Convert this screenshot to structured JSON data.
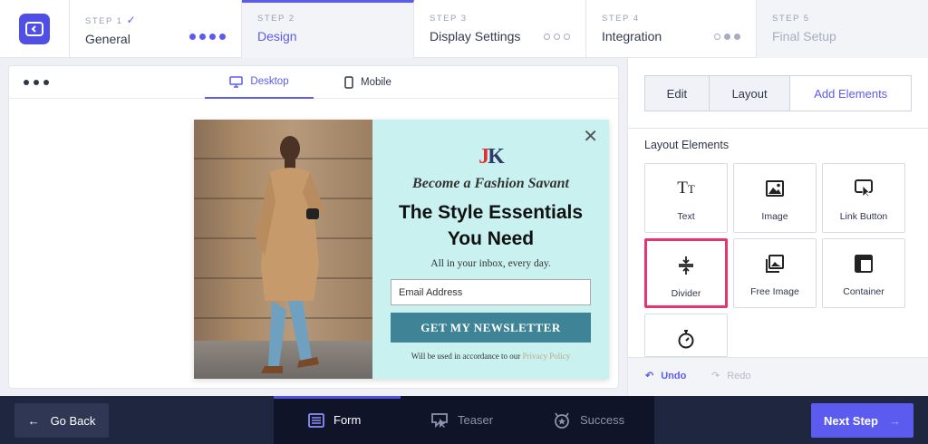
{
  "steps": [
    {
      "num": "STEP 1",
      "title": "General"
    },
    {
      "num": "STEP 2",
      "title": "Design"
    },
    {
      "num": "STEP 3",
      "title": "Display Settings"
    },
    {
      "num": "STEP 4",
      "title": "Integration"
    },
    {
      "num": "STEP 5",
      "title": "Final Setup"
    }
  ],
  "preview": {
    "tab_desktop": "Desktop",
    "tab_mobile": "Mobile"
  },
  "popup": {
    "brand_j": "J",
    "brand_k": "K",
    "tagline": "Become a Fashion Savant",
    "headline_line1": "The Style Essentials",
    "headline_line2": "You Need",
    "subtext": "All in your inbox, every day.",
    "email_placeholder": "Email Address",
    "cta": "GET MY NEWSLETTER",
    "note_prefix": "Will be used in accordance to our",
    "note_link": "Privacy Policy"
  },
  "panel": {
    "tabs": [
      "Edit",
      "Layout",
      "Add Elements"
    ],
    "section_label": "Layout Elements",
    "elements": [
      "Text",
      "Image",
      "Link Button",
      "Divider",
      "Free Image",
      "Container"
    ],
    "undo": "Undo",
    "redo": "Redo"
  },
  "bottom": {
    "back": "Go Back",
    "tabs": [
      "Form",
      "Teaser",
      "Success"
    ],
    "next": "Next Step"
  },
  "colors": {
    "accent": "#5b5bf0",
    "highlight": "#e8336d",
    "cta": "#3e8396",
    "popup_bg": "#c9f1f0"
  }
}
